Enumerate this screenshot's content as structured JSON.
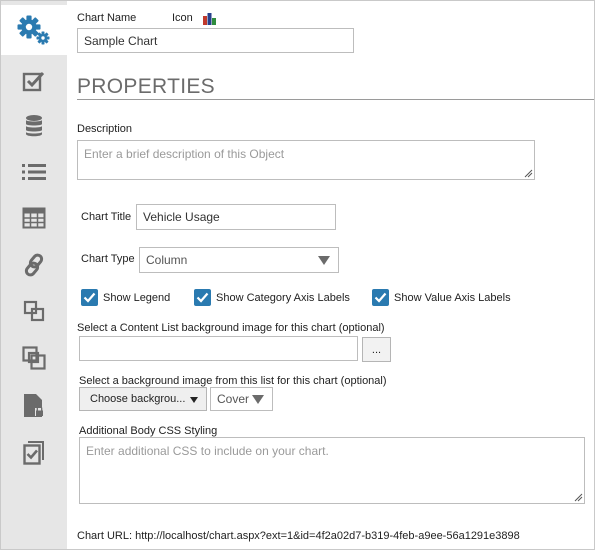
{
  "header": {
    "chart_name_label": "Chart Name",
    "icon_label": "Icon",
    "chart_name_value": "Sample Chart"
  },
  "section": {
    "title": "PROPERTIES"
  },
  "description": {
    "label": "Description",
    "placeholder": "Enter a brief description of this Object"
  },
  "chart_title": {
    "label": "Chart Title",
    "value": "Vehicle Usage"
  },
  "chart_type": {
    "label": "Chart Type",
    "value": "Column"
  },
  "checkboxes": {
    "show_legend": "Show Legend",
    "show_category_axis_labels": "Show Category Axis Labels",
    "show_value_axis_labels": "Show Value Axis Labels"
  },
  "content_list_bg": {
    "label": "Select a Content List background image for this chart (optional)",
    "value": "",
    "browse_label": "..."
  },
  "bg_image": {
    "label": "Select a background image from this list for this chart (optional)",
    "choose_label": "Choose backgrou...",
    "fit_value": "Cover"
  },
  "css": {
    "label": "Additional Body CSS Styling",
    "placeholder": "Enter additional CSS to include on your chart."
  },
  "chart_url": "Chart URL: http://localhost/chart.aspx?ext=1&id=4f2a02d7-b319-4feb-a9ee-56a1291e3898",
  "sidebar": {
    "items": [
      "settings-icon",
      "checklist-icon",
      "database-icon",
      "list-icon",
      "table-icon",
      "link-icon",
      "layers-icon",
      "nested-squares-icon",
      "locked-file-icon",
      "checked-pages-icon"
    ]
  },
  "colors": {
    "accent": "#2a7ab0",
    "sidebar_bg": "#e6e6e6",
    "icon": "#6b6b6b"
  }
}
